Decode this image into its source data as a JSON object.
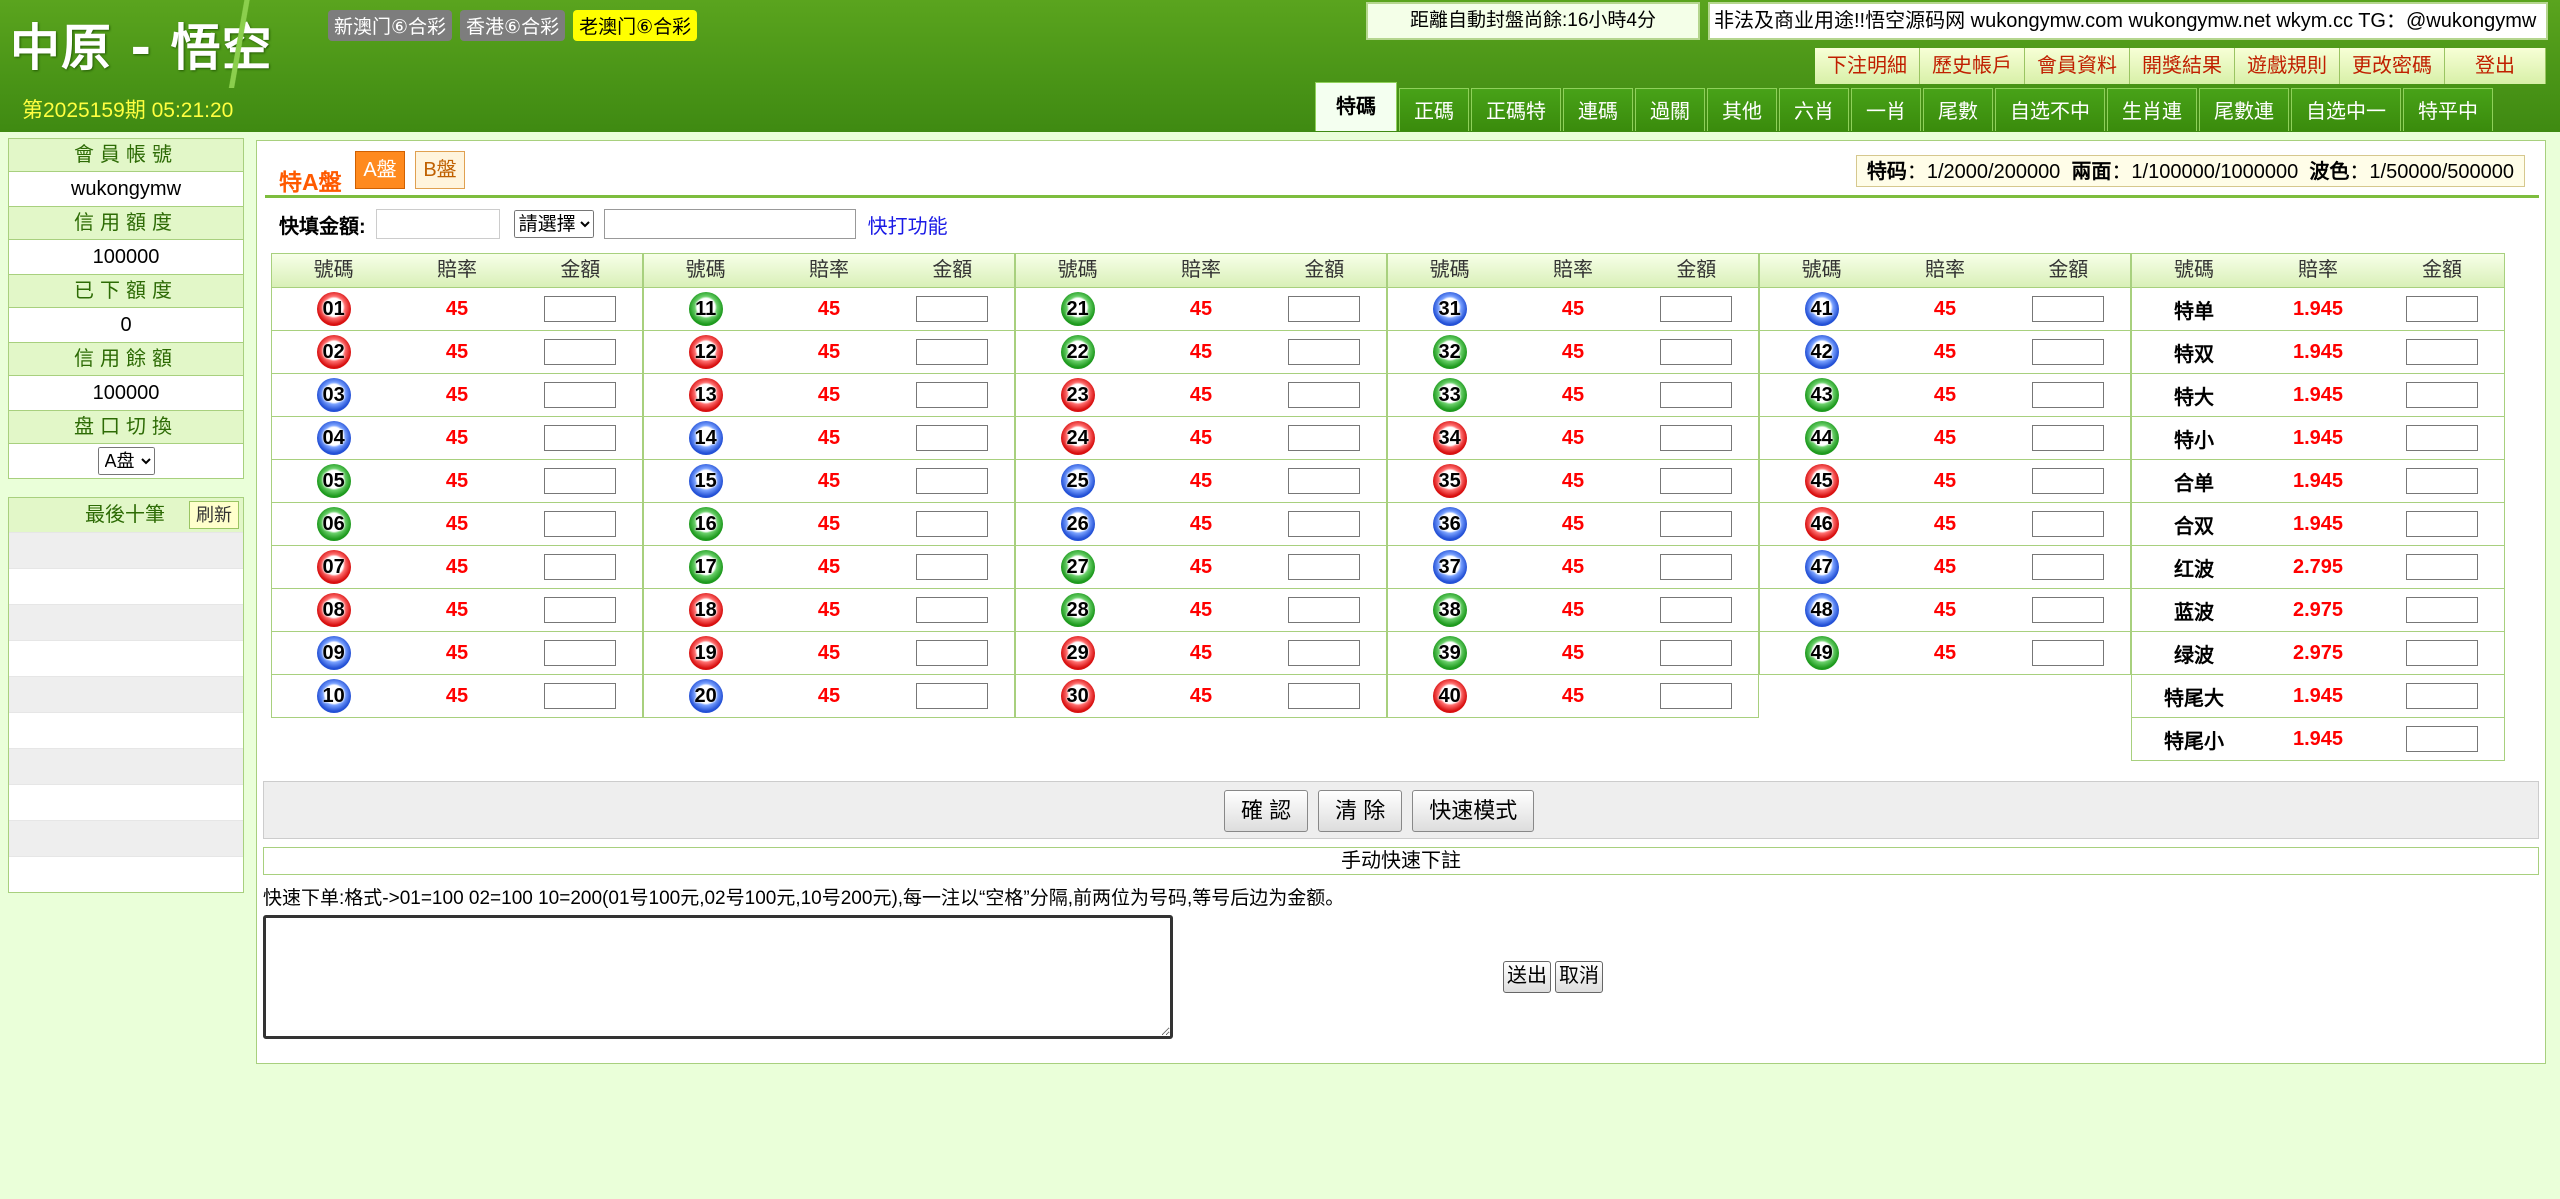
{
  "header": {
    "logo": "中原 - 悟空",
    "period": "第2025159期 05:21:20",
    "lottery_tabs": [
      "新澳门⑥合彩",
      "香港⑥合彩",
      "老澳门⑥合彩"
    ],
    "countdown": "距離自動封盤尚餘:16小時4分",
    "notice": "非法及商业用途!!悟空源码网 wukongymw.com wukongymw.net wkym.cc TG：@wukongymw",
    "top_links": [
      "下注明細",
      "歷史帳戶",
      "會員資料",
      "開獎結果",
      "遊戲規則",
      "更改密碼",
      "登出"
    ],
    "main_tabs": [
      "特碼",
      "正碼",
      "正碼特",
      "連碼",
      "過關",
      "其他",
      "六肖",
      "一肖",
      "尾數",
      "自选不中",
      "生肖連",
      "尾數連",
      "自选中一",
      "特平中"
    ]
  },
  "sidebar": {
    "account_label": "會員帳號",
    "account_value": "wukongymw",
    "credit_label": "信用額度",
    "credit_value": "100000",
    "bet_label": "已下額度",
    "bet_value": "0",
    "balance_label": "信用餘額",
    "balance_value": "100000",
    "plate_label": "盘口切換",
    "plate_value": "A盘",
    "recent_label": "最後十筆",
    "refresh_label": "刷新"
  },
  "panel": {
    "title": "特A盤",
    "btn_a": "A盤",
    "btn_b": "B盤",
    "limits": {
      "l1": "特码",
      "v1": "：1/2000/200000",
      "l2": "兩面",
      "v2": "：1/100000/1000000",
      "l3": "波色",
      "v3": "：1/50000/500000"
    },
    "quick_label": "快填金額:",
    "quick_select": "請選擇",
    "quick_link": "快打功能",
    "headers": {
      "num": "號碼",
      "odds": "賠率",
      "amount": "金額"
    }
  },
  "balls": {
    "colors": {
      "red": "#d81010",
      "blue": "#2451d6",
      "green": "#1e9a1e"
    },
    "odds": "45",
    "items": [
      {
        "n": "01",
        "c": "red"
      },
      {
        "n": "02",
        "c": "red"
      },
      {
        "n": "03",
        "c": "blue"
      },
      {
        "n": "04",
        "c": "blue"
      },
      {
        "n": "05",
        "c": "green"
      },
      {
        "n": "06",
        "c": "green"
      },
      {
        "n": "07",
        "c": "red"
      },
      {
        "n": "08",
        "c": "red"
      },
      {
        "n": "09",
        "c": "blue"
      },
      {
        "n": "10",
        "c": "blue"
      },
      {
        "n": "11",
        "c": "green"
      },
      {
        "n": "12",
        "c": "red"
      },
      {
        "n": "13",
        "c": "red"
      },
      {
        "n": "14",
        "c": "blue"
      },
      {
        "n": "15",
        "c": "blue"
      },
      {
        "n": "16",
        "c": "green"
      },
      {
        "n": "17",
        "c": "green"
      },
      {
        "n": "18",
        "c": "red"
      },
      {
        "n": "19",
        "c": "red"
      },
      {
        "n": "20",
        "c": "blue"
      },
      {
        "n": "21",
        "c": "green"
      },
      {
        "n": "22",
        "c": "green"
      },
      {
        "n": "23",
        "c": "red"
      },
      {
        "n": "24",
        "c": "red"
      },
      {
        "n": "25",
        "c": "blue"
      },
      {
        "n": "26",
        "c": "blue"
      },
      {
        "n": "27",
        "c": "green"
      },
      {
        "n": "28",
        "c": "green"
      },
      {
        "n": "29",
        "c": "red"
      },
      {
        "n": "30",
        "c": "red"
      },
      {
        "n": "31",
        "c": "blue"
      },
      {
        "n": "32",
        "c": "green"
      },
      {
        "n": "33",
        "c": "green"
      },
      {
        "n": "34",
        "c": "red"
      },
      {
        "n": "35",
        "c": "red"
      },
      {
        "n": "36",
        "c": "blue"
      },
      {
        "n": "37",
        "c": "blue"
      },
      {
        "n": "38",
        "c": "green"
      },
      {
        "n": "39",
        "c": "green"
      },
      {
        "n": "40",
        "c": "red"
      },
      {
        "n": "41",
        "c": "blue"
      },
      {
        "n": "42",
        "c": "blue"
      },
      {
        "n": "43",
        "c": "green"
      },
      {
        "n": "44",
        "c": "green"
      },
      {
        "n": "45",
        "c": "red"
      },
      {
        "n": "46",
        "c": "red"
      },
      {
        "n": "47",
        "c": "blue"
      },
      {
        "n": "48",
        "c": "blue"
      },
      {
        "n": "49",
        "c": "green"
      }
    ]
  },
  "specials": [
    {
      "label": "特单",
      "odds": "1.945"
    },
    {
      "label": "特双",
      "odds": "1.945"
    },
    {
      "label": "特大",
      "odds": "1.945"
    },
    {
      "label": "特小",
      "odds": "1.945"
    },
    {
      "label": "合单",
      "odds": "1.945"
    },
    {
      "label": "合双",
      "odds": "1.945"
    },
    {
      "label": "红波",
      "odds": "2.795"
    },
    {
      "label": "蓝波",
      "odds": "2.975"
    },
    {
      "label": "绿波",
      "odds": "2.975"
    },
    {
      "label": "特尾大",
      "odds": "1.945"
    },
    {
      "label": "特尾小",
      "odds": "1.945"
    }
  ],
  "actions": {
    "confirm": "確 認",
    "clear": "清 除",
    "quick_mode": "快速模式"
  },
  "manual": {
    "title": "手动快速下註",
    "hint": "快速下单:格式->01=100 02=100 10=200(01号100元,02号100元,10号200元),每一注以“空格”分隔,前两位为号码,等号后边为金额。",
    "submit": "送出",
    "cancel": "取消"
  }
}
